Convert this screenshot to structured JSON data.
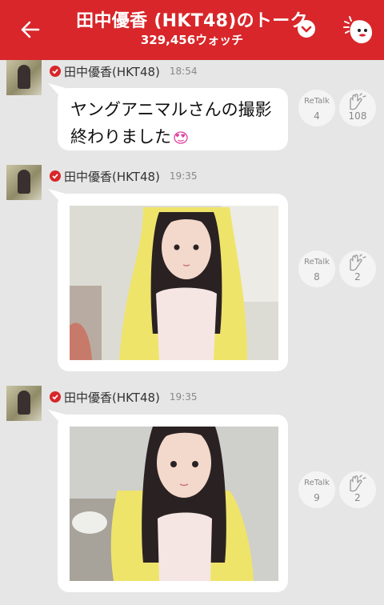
{
  "colors": {
    "accent": "#d8262a",
    "background": "#e6e6e6",
    "bubble": "#ffffff"
  },
  "header": {
    "title": "田中優香 (HKT48)のトーク",
    "watch_count": "329,456ウォッチ",
    "icons": [
      "back-arrow-icon",
      "chevron-down-icon",
      "mascot-icon"
    ]
  },
  "messages": [
    {
      "author": "田中優香(HKT48)",
      "time": "18:54",
      "type": "text",
      "text_line1": "ヤングアニマルさんの撮影",
      "text_line2": "終わりました",
      "emoji": "heart-eyes-emoji",
      "retalk_label": "ReTalk",
      "retalk_count": "4",
      "clap_count": "108"
    },
    {
      "author": "田中優香(HKT48)",
      "time": "19:35",
      "type": "photo",
      "retalk_label": "ReTalk",
      "retalk_count": "8",
      "clap_count": "2"
    },
    {
      "author": "田中優香(HKT48)",
      "time": "19:35",
      "type": "photo",
      "retalk_label": "ReTalk",
      "retalk_count": "9",
      "clap_count": "2"
    }
  ]
}
